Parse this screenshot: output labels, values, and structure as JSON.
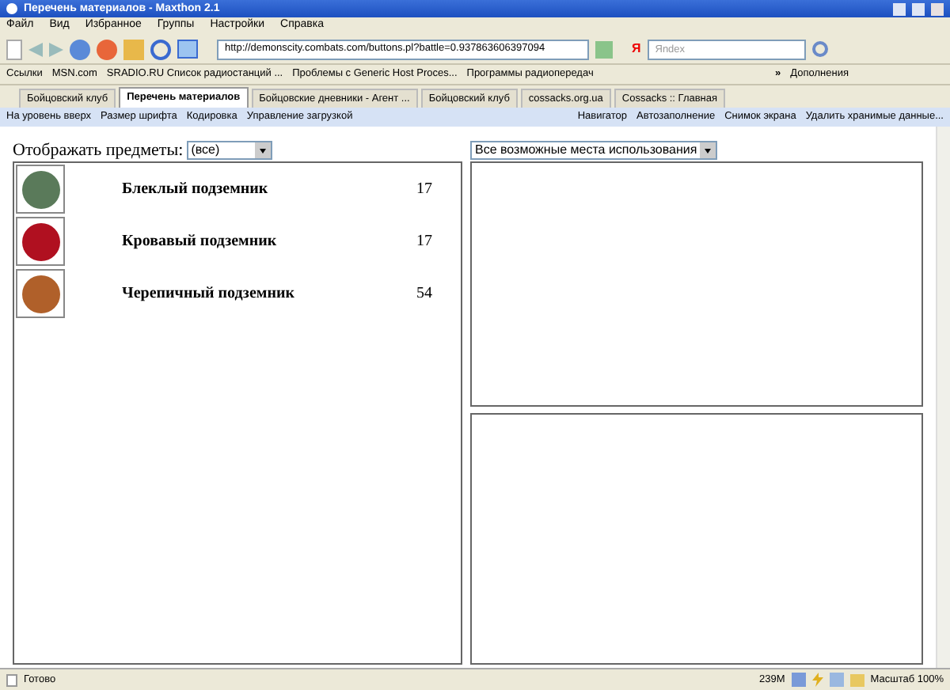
{
  "window": {
    "title": "Перечень материалов - Maxthon 2.1"
  },
  "menu": [
    "Файл",
    "Вид",
    "Избранное",
    "Группы",
    "Настройки",
    "Справка"
  ],
  "address_bar": {
    "value": "http://demonscity.combats.com/buttons.pl?battle=0.937863606397094"
  },
  "search": {
    "logo": "Я",
    "placeholder": "Яndex"
  },
  "links_bar": {
    "items": [
      "Ссылки",
      "MSN.com",
      "SRADIO.RU Список радиостанций ...",
      "Проблемы с Generic Host Proces...",
      "Программы радиопередач"
    ],
    "overflow": "»",
    "addons": "Дополнения"
  },
  "tabs": [
    {
      "label": "Бойцовский клуб",
      "selected": false
    },
    {
      "label": "Перечень материалов",
      "selected": true
    },
    {
      "label": "Бойцовские дневники - Агент ...",
      "selected": false
    },
    {
      "label": "Бойцовский клуб",
      "selected": false
    },
    {
      "label": "cossacks.org.ua",
      "selected": false
    },
    {
      "label": "Cossacks :: Главная",
      "selected": false
    }
  ],
  "plugin_bar": {
    "left": [
      "На уровень вверх",
      "Размер шрифта",
      "Кодировка",
      "Управление загрузкой"
    ],
    "right": [
      "Навигатор",
      "Автозаполнение",
      "Снимок экрана",
      "Удалить хранимые данные..."
    ]
  },
  "page": {
    "filter_label": "Отображать предметы:",
    "filter_value": "(все)",
    "places_value": "Все возможные места использования",
    "items": [
      {
        "name": "Блеклый подземник",
        "count": "17",
        "color": "#5a7a5a"
      },
      {
        "name": "Кровавый подземник",
        "count": "17",
        "color": "#b01020"
      },
      {
        "name": "Черепичный подземник",
        "count": "54",
        "color": "#b0602a"
      }
    ]
  },
  "status_bar": {
    "text": "Готово",
    "memory": "239M",
    "zoom": "Масштаб 100%"
  }
}
